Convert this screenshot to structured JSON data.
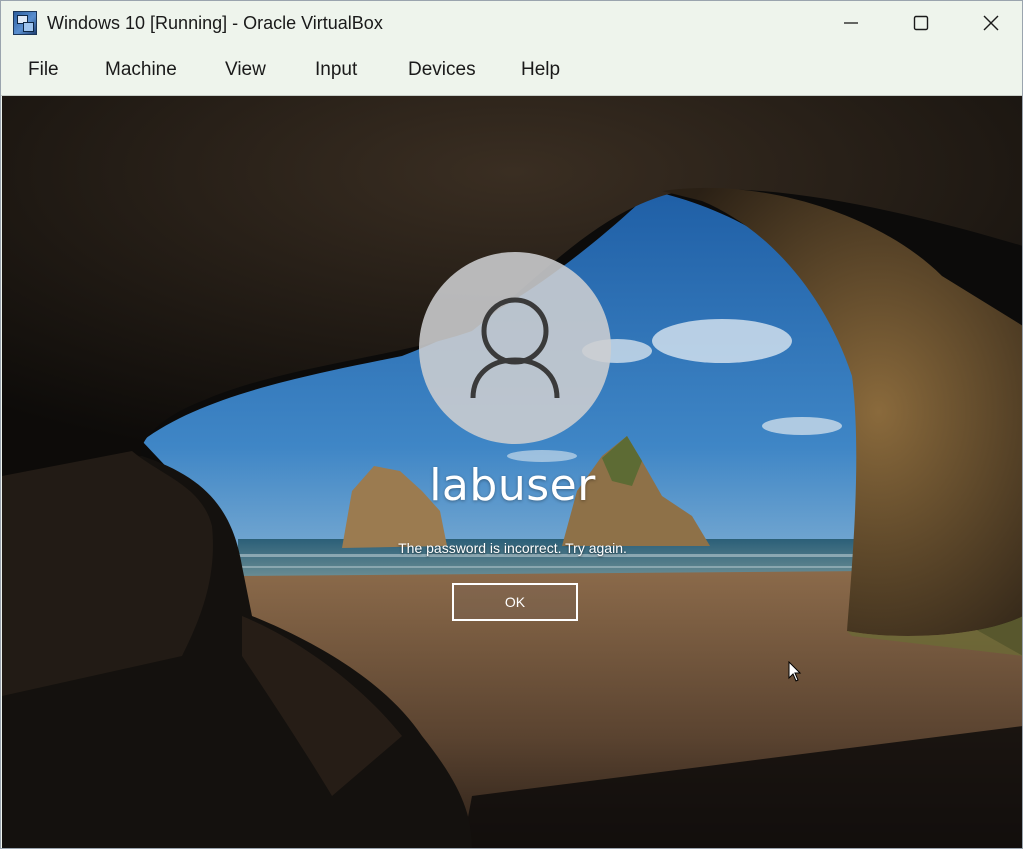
{
  "window": {
    "title": "Windows 10 [Running] - Oracle VirtualBox",
    "app_icon": "virtualbox-icon",
    "controls": [
      "minimize-icon",
      "maximize-icon",
      "close-icon"
    ]
  },
  "menubar": {
    "items": [
      {
        "label": "File"
      },
      {
        "label": "Machine"
      },
      {
        "label": "View"
      },
      {
        "label": "Input"
      },
      {
        "label": "Devices"
      },
      {
        "label": "Help"
      }
    ]
  },
  "lock_screen": {
    "avatar_icon": "user-icon",
    "username": "labuser",
    "message": "The password is incorrect. Try again.",
    "ok_label": "OK"
  }
}
